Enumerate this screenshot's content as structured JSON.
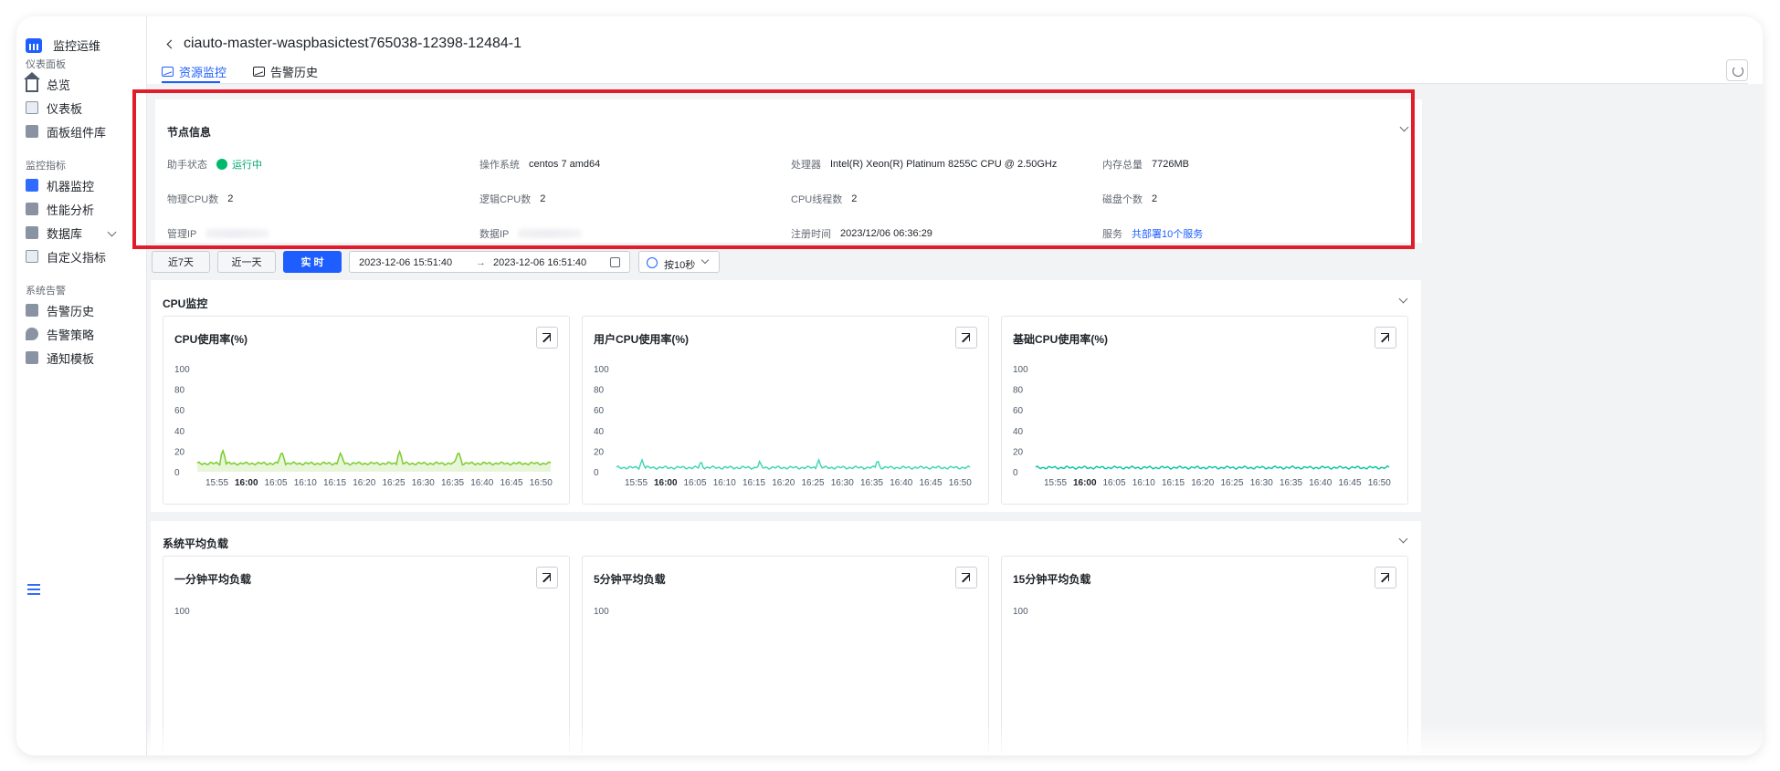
{
  "sidebar": {
    "brand": "监控运维",
    "groups": [
      {
        "title": "仪表面板",
        "items": [
          "总览",
          "仪表板",
          "面板组件库"
        ]
      },
      {
        "title": "监控指标",
        "items": [
          "机器监控",
          "性能分析",
          "数据库",
          "自定义指标"
        ]
      },
      {
        "title": "系统告警",
        "items": [
          "告警历史",
          "告警策略",
          "通知模板"
        ]
      }
    ]
  },
  "header": {
    "title": "ciauto-master-waspbasictest765038-12398-12484-1",
    "tabs": [
      "资源监控",
      "告警历史"
    ]
  },
  "node_info": {
    "title": "节点信息",
    "fields": {
      "agent_status_label": "助手状态",
      "agent_status_value": "运行中",
      "os_label": "操作系统",
      "os_value": "centos 7 amd64",
      "cpu_label": "处理器",
      "cpu_value": "Intel(R) Xeon(R) Platinum 8255C CPU @ 2.50GHz",
      "mem_label": "内存总量",
      "mem_value": "7726MB",
      "phys_cpu_label": "物理CPU数",
      "phys_cpu_value": "2",
      "logic_cpu_label": "逻辑CPU数",
      "logic_cpu_value": "2",
      "threads_label": "CPU线程数",
      "threads_value": "2",
      "disks_label": "磁盘个数",
      "disks_value": "2",
      "mgmt_ip_label": "管理IP",
      "data_ip_label": "数据IP",
      "reg_time_label": "注册时间",
      "reg_time_value": "2023/12/06 06:36:29",
      "service_label": "服务",
      "service_value": "共部署10个服务"
    }
  },
  "toolbar": {
    "btn_7d": "近7天",
    "btn_1d": "近一天",
    "btn_realtime": "实 时",
    "range_start": "2023-12-06 15:51:40",
    "range_arrow": "→",
    "range_end": "2023-12-06 16:51:40",
    "interval": "按10秒"
  },
  "sections": [
    {
      "title": "CPU监控",
      "charts": [
        "CPU使用率(%)",
        "用户CPU使用率(%)",
        "基础CPU使用率(%)"
      ]
    },
    {
      "title": "系统平均负载",
      "charts": [
        "一分钟平均负载",
        "5分钟平均负载",
        "15分钟平均负载"
      ]
    }
  ],
  "chart_data": [
    {
      "type": "line",
      "title": "CPU使用率(%)",
      "ylim": [
        0,
        100
      ],
      "y_ticks": [
        "100",
        "80",
        "60",
        "40",
        "20",
        "0"
      ],
      "x_ticks": [
        "15:55",
        "16:00",
        "16:05",
        "16:10",
        "16:15",
        "16:20",
        "16:25",
        "16:30",
        "16:35",
        "16:40",
        "16:45",
        "16:50"
      ],
      "color": "#7ccc2c",
      "area": true,
      "baseline": 8,
      "spikes": [
        {
          "x": "15:56",
          "y": 21
        },
        {
          "x": "16:06",
          "y": 20
        },
        {
          "x": "16:16",
          "y": 19
        },
        {
          "x": "16:26",
          "y": 20
        },
        {
          "x": "16:36",
          "y": 20
        }
      ]
    },
    {
      "type": "line",
      "title": "用户CPU使用率(%)",
      "ylim": [
        0,
        100
      ],
      "y_ticks": [
        "100",
        "80",
        "60",
        "40",
        "20",
        "0"
      ],
      "x_ticks": [
        "15:55",
        "16:00",
        "16:05",
        "16:10",
        "16:15",
        "16:20",
        "16:25",
        "16:30",
        "16:35",
        "16:40",
        "16:45",
        "16:50"
      ],
      "color": "#44d7b6",
      "area": false,
      "baseline": 4,
      "spikes": [
        {
          "x": "15:56",
          "y": 12
        },
        {
          "x": "16:06",
          "y": 11
        },
        {
          "x": "16:16",
          "y": 11
        },
        {
          "x": "16:26",
          "y": 12
        },
        {
          "x": "16:36",
          "y": 12
        }
      ]
    },
    {
      "type": "line",
      "title": "基础CPU使用率(%)",
      "ylim": [
        0,
        100
      ],
      "y_ticks": [
        "100",
        "80",
        "60",
        "40",
        "20",
        "0"
      ],
      "x_ticks": [
        "15:55",
        "16:00",
        "16:05",
        "16:10",
        "16:15",
        "16:20",
        "16:25",
        "16:30",
        "16:35",
        "16:40",
        "16:45",
        "16:50"
      ],
      "color": "#15c7a8",
      "area": false,
      "baseline": 4,
      "spikes": []
    }
  ],
  "load_chart_tick_partial": "100"
}
